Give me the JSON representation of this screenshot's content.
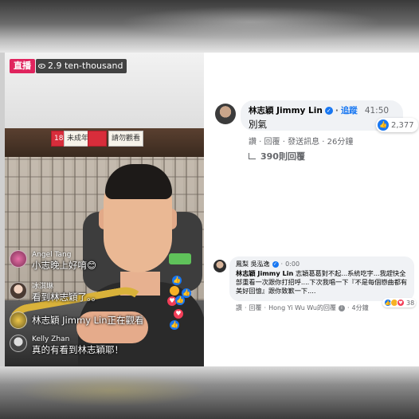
{
  "live": {
    "badge": "直播",
    "views": "2.9 ten-thousand",
    "signs": {
      "age": "18",
      "age_text": "未成年",
      "mid": "",
      "watch_warn": "請勿觀看"
    }
  },
  "live_comments": [
    {
      "name": "Angel Tang",
      "text": "小志晚上好唷😊"
    },
    {
      "name": "冰淇琳",
      "text": "看到林志穎了。。"
    },
    {
      "name": "Kelly Zhan",
      "text": "真的有看到林志穎耶！"
    }
  ],
  "watching_text": "林志穎 Jimmy Lin正在觀看",
  "comment1": {
    "name": "林志穎 Jimmy Lin",
    "follow": "追蹤",
    "timestamp": "41:50",
    "text": "別氣",
    "likes": "2,377",
    "actions": "讚 · 回覆 · 發送訊息 · 26分鐘",
    "replies": "390則回覆"
  },
  "comment2": {
    "name": "鳳梨 吳泓逸",
    "timestamp": "0:00",
    "author_tag": "林志穎 Jimmy Lin",
    "text": " 志穎葛葛對不起...系統吃字...我趕快全部重看一次跟你打招呼....下次我唱一下『不是每個戀曲都有美好回憶』跟你致歉一下....",
    "actions_like": "讚",
    "actions_reply": "回覆",
    "reply_meta": "Hong Yi Wu Wu的回覆",
    "age": "4分鐘",
    "reactions": "38"
  },
  "colors": {
    "fb_blue": "#1877f2",
    "live_red": "#e0245e",
    "bubble": "#f0f2f5"
  }
}
